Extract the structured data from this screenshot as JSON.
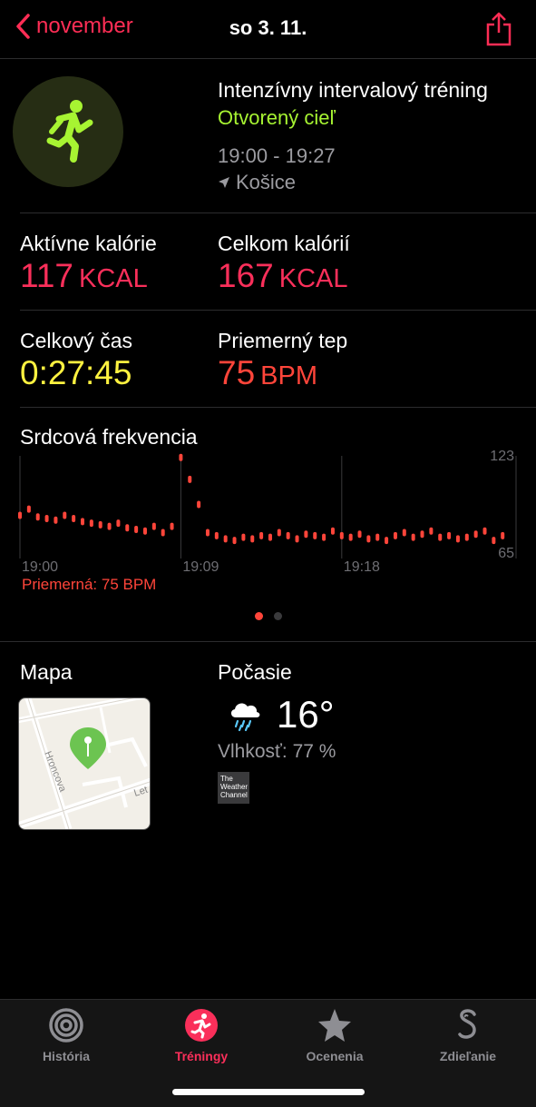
{
  "nav": {
    "back_label": "november",
    "title": "so 3. 11."
  },
  "workout": {
    "title": "Intenzívny intervalový tréning",
    "goal": "Otvorený cieľ",
    "time_range": "19:00 - 19:27",
    "location": "Košice"
  },
  "stats": {
    "active_cal_label": "Aktívne kalórie",
    "active_cal_value": "117",
    "active_cal_unit": "KCAL",
    "total_cal_label": "Celkom kalórií",
    "total_cal_value": "167",
    "total_cal_unit": "KCAL",
    "total_time_label": "Celkový čas",
    "total_time_value": "0:27:45",
    "avg_hr_label": "Priemerný tep",
    "avg_hr_value": "75",
    "avg_hr_unit": "BPM"
  },
  "heart_rate": {
    "title": "Srdcová frekvencia",
    "average_label": "Priemerná: 75 BPM"
  },
  "chart_data": {
    "type": "scatter",
    "title": "Srdcová frekvencia",
    "x_ticks": [
      "19:00",
      "19:09",
      "19:18"
    ],
    "x_unit": "minutes after 19:00",
    "y_tick_labels": [
      "123",
      "65"
    ],
    "ylim": [
      65,
      123
    ],
    "series": [
      {
        "color": "#ff453a",
        "x": [
          0.0,
          0.5,
          1.0,
          1.5,
          2.0,
          2.5,
          3.0,
          3.5,
          4.0,
          4.5,
          5.0,
          5.5,
          6.0,
          6.5,
          7.0,
          7.5,
          8.0,
          8.5,
          9.0,
          9.5,
          10.0,
          10.5,
          11.0,
          11.5,
          12.0,
          12.5,
          13.0,
          13.5,
          14.0,
          14.5,
          15.0,
          15.5,
          16.0,
          16.5,
          17.0,
          17.5,
          18.0,
          18.5,
          19.0,
          19.5,
          20.0,
          20.5,
          21.0,
          21.5,
          22.0,
          22.5,
          23.0,
          23.5,
          24.0,
          24.5,
          25.0,
          25.5,
          26.0,
          26.5,
          27.0
        ],
        "y": [
          85,
          89,
          84,
          83,
          82,
          85,
          83,
          81,
          80,
          79,
          78,
          80,
          77,
          76,
          75,
          78,
          74,
          78,
          122,
          108,
          92,
          74,
          72,
          70,
          69,
          71,
          70,
          72,
          71,
          74,
          72,
          70,
          73,
          72,
          71,
          75,
          72,
          71,
          73,
          70,
          71,
          69,
          72,
          74,
          71,
          73,
          75,
          71,
          72,
          70,
          71,
          73,
          75,
          69,
          72
        ]
      }
    ]
  },
  "pager": {
    "count": 2,
    "active": 0
  },
  "map": {
    "title": "Mapa",
    "street_1": "Hroncova",
    "street_2": "Let"
  },
  "weather": {
    "title": "Počasie",
    "temperature": "16°",
    "humidity": "Vlhkosť: 77 %",
    "provider_logo_text": "The Weather Channel",
    "icon": "cloud-rain-icon"
  },
  "tabs": [
    {
      "label": "História",
      "icon": "activity-rings-icon",
      "active": false
    },
    {
      "label": "Tréningy",
      "icon": "runner-icon",
      "active": true
    },
    {
      "label": "Ocenenia",
      "icon": "award-star-icon",
      "active": false
    },
    {
      "label": "Zdieľanie",
      "icon": "sharing-icon",
      "active": false
    }
  ],
  "colors": {
    "accent": "#fa2f5a",
    "goal_green": "#a7f432",
    "time_yellow": "#fff240",
    "heart_orange": "#ff453a"
  }
}
